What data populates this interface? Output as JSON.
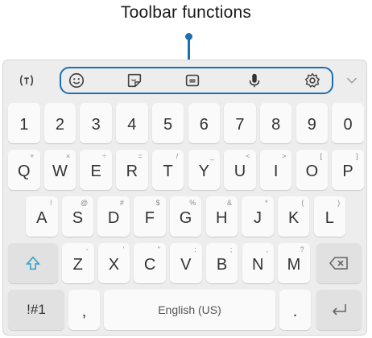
{
  "annotation": {
    "title": "Toolbar functions"
  },
  "toolbar": {
    "mode_icon": "text-mode-icon",
    "icons": [
      "emoji-icon",
      "sticker-icon",
      "gif-icon",
      "microphone-icon",
      "settings-icon"
    ],
    "collapse_icon": "chevron-down-icon"
  },
  "keyboard": {
    "number_row": [
      {
        "label": "1"
      },
      {
        "label": "2"
      },
      {
        "label": "3"
      },
      {
        "label": "4"
      },
      {
        "label": "5"
      },
      {
        "label": "6"
      },
      {
        "label": "7"
      },
      {
        "label": "8"
      },
      {
        "label": "9"
      },
      {
        "label": "0"
      }
    ],
    "row1": [
      {
        "label": "Q",
        "hint": "+"
      },
      {
        "label": "W",
        "hint": "×"
      },
      {
        "label": "E",
        "hint": "÷"
      },
      {
        "label": "R",
        "hint": "="
      },
      {
        "label": "T",
        "hint": "/"
      },
      {
        "label": "Y",
        "hint": "_"
      },
      {
        "label": "U",
        "hint": "<"
      },
      {
        "label": "I",
        "hint": ">"
      },
      {
        "label": "O",
        "hint": "["
      },
      {
        "label": "P",
        "hint": "]"
      }
    ],
    "row2": [
      {
        "label": "A",
        "hint": "!"
      },
      {
        "label": "S",
        "hint": "@"
      },
      {
        "label": "D",
        "hint": "#"
      },
      {
        "label": "F",
        "hint": "$"
      },
      {
        "label": "G",
        "hint": "%"
      },
      {
        "label": "H",
        "hint": "&"
      },
      {
        "label": "J",
        "hint": "*"
      },
      {
        "label": "K",
        "hint": "("
      },
      {
        "label": "L",
        "hint": ")"
      }
    ],
    "row3": [
      {
        "label": "Z",
        "hint": "-"
      },
      {
        "label": "X",
        "hint": "'"
      },
      {
        "label": "C",
        "hint": "\""
      },
      {
        "label": "V",
        "hint": ":"
      },
      {
        "label": "B",
        "hint": ";"
      },
      {
        "label": "N",
        "hint": ","
      },
      {
        "label": "M",
        "hint": "?"
      }
    ],
    "symbols_label": "!#1",
    "comma_label": ",",
    "space_label": "English (US)",
    "period_label": ".",
    "shift_icon": "shift-icon",
    "backspace_icon": "backspace-icon",
    "enter_icon": "enter-icon"
  },
  "colors": {
    "accent": "#1f6fb0",
    "keyboard_bg": "#ededed",
    "key_bg": "#fafafa",
    "shift": "#3aa3c9"
  }
}
